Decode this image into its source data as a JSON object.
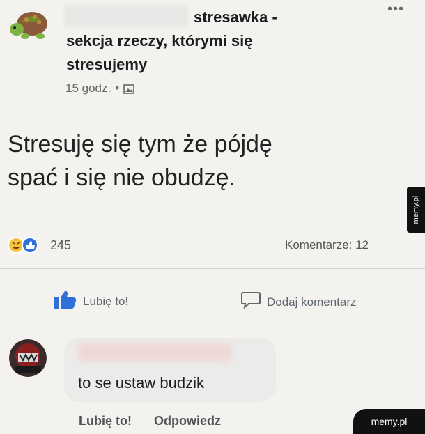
{
  "post": {
    "group_name_line1": "stresawka -",
    "group_name_line2": "sekcja rzeczy, którymi się",
    "group_name_line3": "stresujemy",
    "time": "15 godz.",
    "separator": "•",
    "icons": {
      "avatar": "turtle-emoji-avatar",
      "menu": "more-dots-icon",
      "audience": "photo-album-icon"
    },
    "text_line1": "Stresuję się tym że pójdę",
    "text_line2": "spać i się nie obudzę.",
    "reactions": {
      "icons": [
        "haha-reaction-icon",
        "like-reaction-icon"
      ],
      "count": "245"
    },
    "comments_label": "Komentarze: 12",
    "actions": {
      "like_label": "Lubię to!",
      "like_icon": "thumbs-up-icon",
      "comment_label": "Dodaj komentarz",
      "comment_icon": "speech-bubble-icon"
    }
  },
  "comment": {
    "text": "to se ustaw budzik",
    "like_label": "Lubię to!",
    "reply_label": "Odpowiedz"
  },
  "watermarks": {
    "side": "memy.pl",
    "corner": "memy.pl"
  },
  "colors": {
    "like_blue": "#2e6fd8",
    "background": "#f3f2ef",
    "muted_text": "#65676b"
  }
}
